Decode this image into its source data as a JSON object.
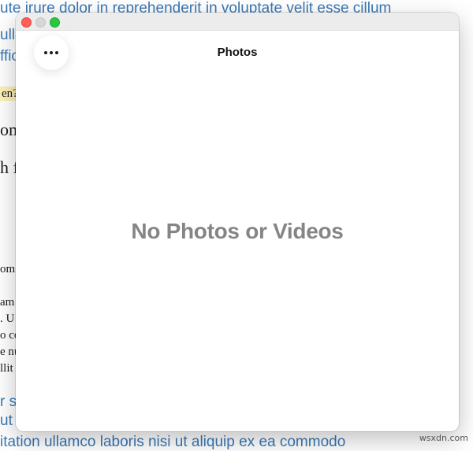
{
  "background_page": {
    "link_line_1": "ute irure dolor in reprehenderit in voluptate velit esse cillum",
    "link_line_2": "ulla",
    "link_line_3": "ffic",
    "highlight": "en?",
    "serif_line_1": "om",
    "serif_line_2": "h f",
    "small_lines": [
      "om",
      "am",
      ". U",
      "o co",
      "e nu",
      "llit"
    ],
    "link_line_4": "r s",
    "link_line_5": "ut",
    "link_line_6": "itation ullamco laboris nisi ut aliquip ex ea commodo"
  },
  "window": {
    "title": "Photos",
    "more_button_label": "More options",
    "empty_state": "No Photos or Videos"
  },
  "watermark": "wsxdn.com",
  "colors": {
    "link": "#3b78b5",
    "empty_text": "#858585",
    "close": "#fe5f57",
    "minimize": "#d6d6d6",
    "maximize": "#28c840"
  }
}
